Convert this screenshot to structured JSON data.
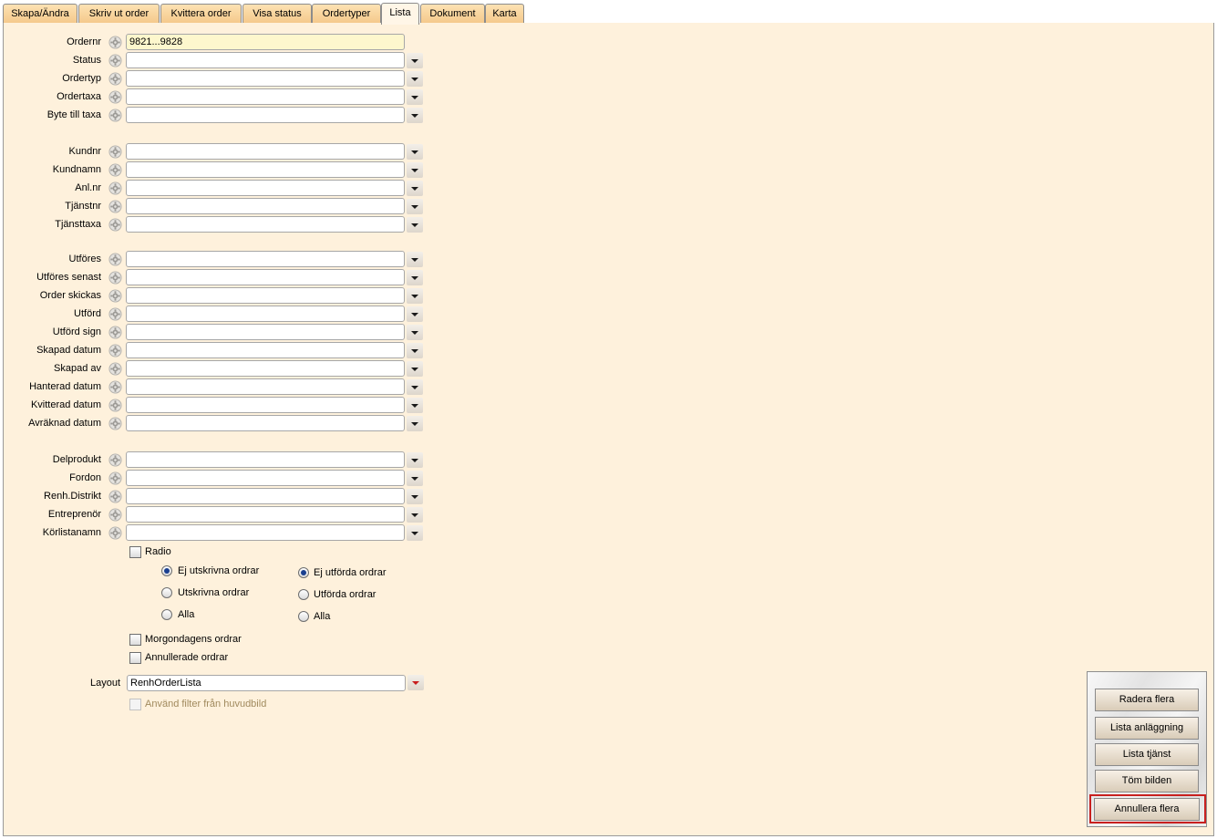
{
  "tabs": [
    {
      "label": "Skapa/Ändra",
      "active": false
    },
    {
      "label": "Skriv ut order",
      "active": false
    },
    {
      "label": "Kvittera order",
      "active": false
    },
    {
      "label": "Visa status",
      "active": false
    },
    {
      "label": "Ordertyper",
      "active": false
    },
    {
      "label": "Lista",
      "active": true
    },
    {
      "label": "Dokument",
      "active": false
    },
    {
      "label": "Karta",
      "active": false
    }
  ],
  "fields": [
    {
      "label": "Ordernr",
      "value": "9821...9828",
      "has_dropdown": false,
      "highlight": true
    },
    {
      "label": "Status",
      "value": "",
      "has_dropdown": true
    },
    {
      "label": "Ordertyp",
      "value": "",
      "has_dropdown": true
    },
    {
      "label": "Ordertaxa",
      "value": "",
      "has_dropdown": true
    },
    {
      "label": "Byte till taxa",
      "value": "",
      "has_dropdown": true
    },
    {
      "label": "Kundnr",
      "value": "",
      "has_dropdown": true
    },
    {
      "label": "Kundnamn",
      "value": "",
      "has_dropdown": true
    },
    {
      "label": "Anl.nr",
      "value": "",
      "has_dropdown": true
    },
    {
      "label": "Tjänstnr",
      "value": "",
      "has_dropdown": true
    },
    {
      "label": "Tjänsttaxa",
      "value": "",
      "has_dropdown": true
    },
    {
      "label": "Utföres",
      "value": "",
      "has_dropdown": true
    },
    {
      "label": "Utföres senast",
      "value": "",
      "has_dropdown": true
    },
    {
      "label": "Order skickas",
      "value": "",
      "has_dropdown": true
    },
    {
      "label": "Utförd",
      "value": "",
      "has_dropdown": true
    },
    {
      "label": "Utförd sign",
      "value": "",
      "has_dropdown": true
    },
    {
      "label": "Skapad datum",
      "value": "",
      "has_dropdown": true
    },
    {
      "label": "Skapad av",
      "value": "",
      "has_dropdown": true
    },
    {
      "label": "Hanterad datum",
      "value": "",
      "has_dropdown": true
    },
    {
      "label": "Kvitterad datum",
      "value": "",
      "has_dropdown": true
    },
    {
      "label": "Avräknad datum",
      "value": "",
      "has_dropdown": true
    },
    {
      "label": "Delprodukt",
      "value": "",
      "has_dropdown": true
    },
    {
      "label": "Fordon",
      "value": "",
      "has_dropdown": true
    },
    {
      "label": "Renh.Distrikt",
      "value": "",
      "has_dropdown": true
    },
    {
      "label": "Entreprenör",
      "value": "",
      "has_dropdown": true
    },
    {
      "label": "Körlistanamn",
      "value": "",
      "has_dropdown": true
    }
  ],
  "options": {
    "radio_checkbox": {
      "label": "Radio",
      "checked": false
    },
    "print_group": [
      {
        "label": "Ej utskrivna ordrar",
        "selected": true
      },
      {
        "label": "Utskrivna ordrar",
        "selected": false
      },
      {
        "label": "Alla",
        "selected": false
      }
    ],
    "done_group": [
      {
        "label": "Ej utförda ordrar",
        "selected": true
      },
      {
        "label": "Utförda ordrar",
        "selected": false
      },
      {
        "label": "Alla",
        "selected": false
      }
    ],
    "morgondagens": {
      "label": "Morgondagens ordrar",
      "checked": false
    },
    "annullerade": {
      "label": "Annullerade ordrar",
      "checked": false
    }
  },
  "layout": {
    "label": "Layout",
    "value": "RenhOrderLista"
  },
  "use_filter": {
    "label": "Använd filter från huvudbild",
    "checked": false,
    "disabled": true
  },
  "actions": {
    "radera": "Radera flera",
    "lista_anl": "Lista anläggning",
    "lista_tjanst": "Lista tjänst",
    "tom": "Töm bilden",
    "annullera": "Annullera flera"
  },
  "colors": {
    "panel_bg": "#fef1dc",
    "tab_bg": "#f7d49a",
    "focus_frame": "#c8201f"
  }
}
